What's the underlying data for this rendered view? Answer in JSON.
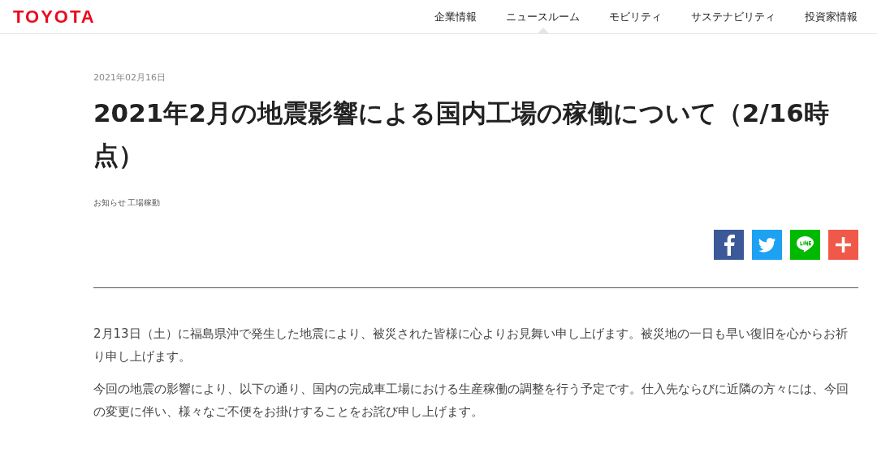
{
  "header": {
    "logo": "TOYOTA",
    "nav": [
      {
        "label": "企業情報",
        "selected": false
      },
      {
        "label": "ニュースルーム",
        "selected": true
      },
      {
        "label": "モビリティ",
        "selected": false
      },
      {
        "label": "サステナビリティ",
        "selected": false
      },
      {
        "label": "投資家情報",
        "selected": false
      }
    ]
  },
  "article": {
    "date": "2021年02月16日",
    "title": "2021年2月の地震影響による国内工場の稼働について（2/16時点）",
    "tags": [
      "お知らせ",
      "工場稼動"
    ],
    "share": [
      {
        "kind": "facebook",
        "color": "#3b5998"
      },
      {
        "kind": "twitter",
        "color": "#1da1f2"
      },
      {
        "kind": "line",
        "color": "#00b900"
      },
      {
        "kind": "more",
        "color": "#f0594a"
      }
    ],
    "paragraphs": [
      "2月13日（土）に福島県沖で発生した地震により、被災された皆様に心よりお見舞い申し上げます。被災地の一日も早い復旧を心からお祈り申し上げます。",
      "今回の地震の影響により、以下の通り、国内の完成車工場における生産稼働の調整を行う予定です。仕入先ならびに近隣の方々には、今回の変更に伴い、様々なご不便をお掛けすることをお詫び申し上げます。"
    ]
  }
}
